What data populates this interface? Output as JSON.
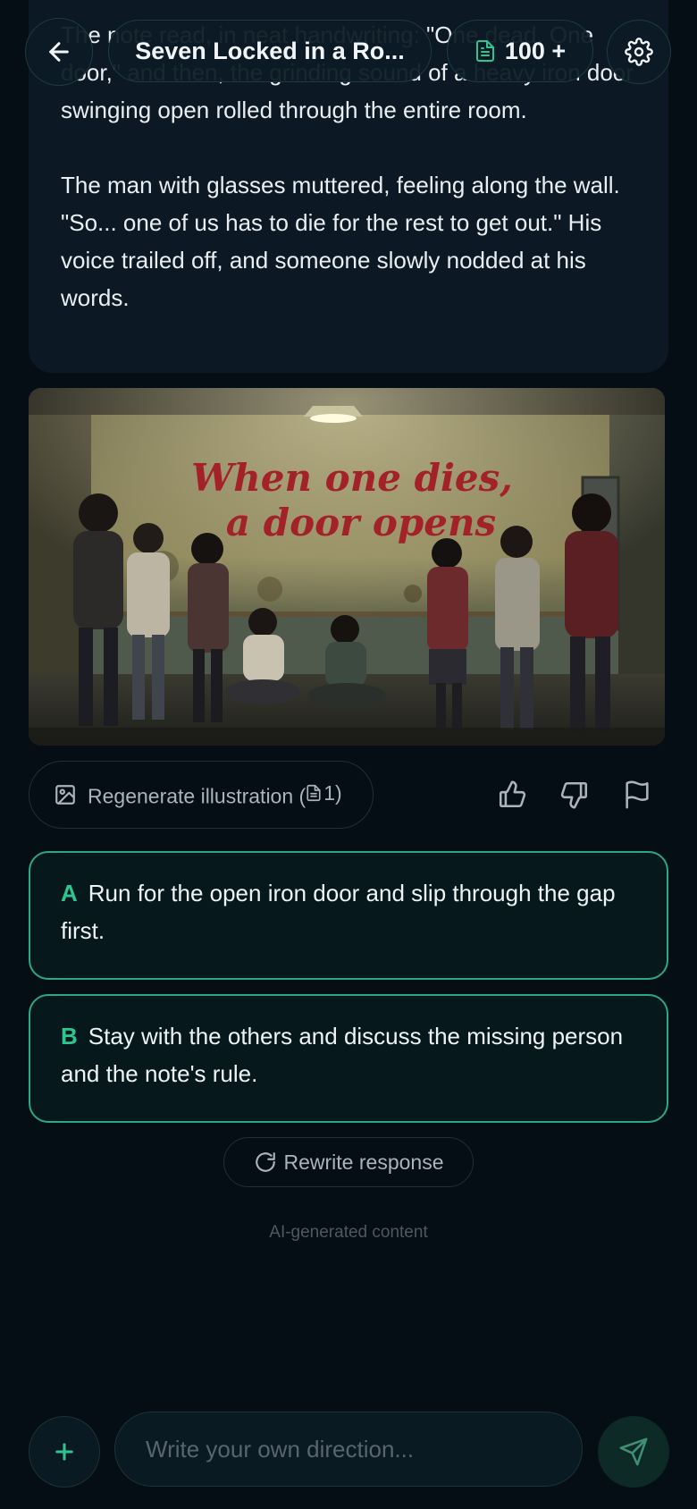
{
  "header": {
    "title": "Seven Locked in a Ro...",
    "credits": "100 +"
  },
  "story": {
    "paragraph_1": "The note read, in neat handwriting: \"One dead. One door,\" and then, the grinding sound of a heavy iron door swinging open rolled through the entire room.",
    "paragraph_2": "The man with glasses muttered, feeling along the wall. \"So... one of us has to die for the rest to get out.\" His voice trailed off, and someone slowly nodded at his words."
  },
  "illustration": {
    "wall_text_line1": "When one dies,",
    "wall_text_line2": "a door opens"
  },
  "actions": {
    "regenerate_label": "Regenerate illustration (",
    "regenerate_cost": "1)"
  },
  "choices": [
    {
      "letter": "A",
      "text": "Run for the open iron door and slip through the gap first."
    },
    {
      "letter": "B",
      "text": "Stay with the others and discuss the missing person and the note's rule."
    }
  ],
  "rewrite_label": "Rewrite response",
  "ai_note": "AI-generated content",
  "input": {
    "placeholder": "Write your own direction..."
  },
  "colors": {
    "accent": "#2fc58f",
    "background": "#050d15",
    "card": "#0c1823"
  }
}
